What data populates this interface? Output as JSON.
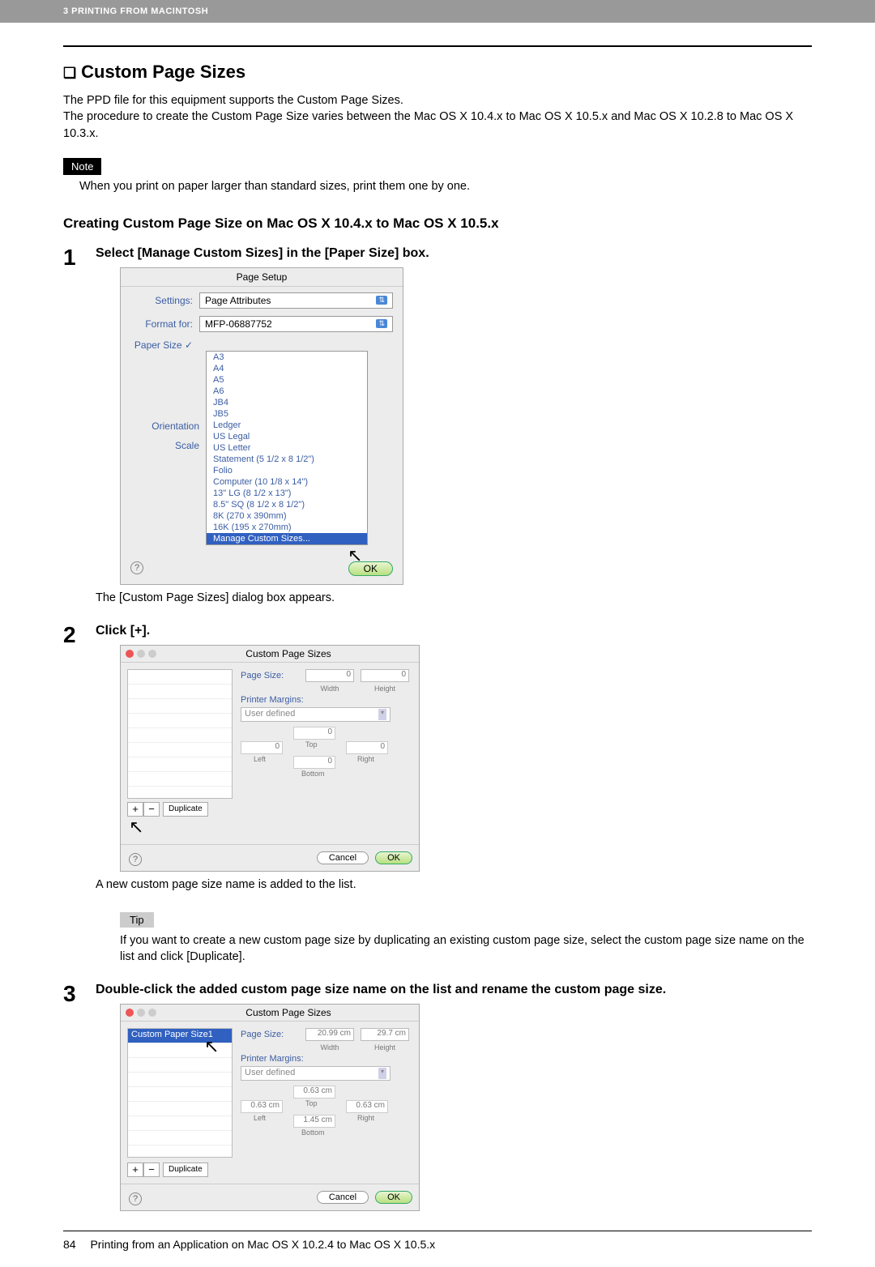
{
  "header": {
    "chapter": "3 PRINTING FROM MACINTOSH"
  },
  "section_title": "Custom Page Sizes",
  "intro": {
    "p1": "The PPD file for this equipment supports the Custom Page Sizes.",
    "p2": "The procedure to create the Custom Page Size varies between the Mac OS X 10.4.x to Mac OS X 10.5.x and Mac OS X 10.2.8 to Mac OS X 10.3.x."
  },
  "note": {
    "label": "Note",
    "text": "When you print on paper larger than standard sizes, print them one by one."
  },
  "subheading": "Creating Custom Page Size on Mac OS X 10.4.x to Mac OS X 10.5.x",
  "steps": {
    "s1": {
      "num": "1",
      "title": "Select [Manage Custom Sizes] in the [Paper Size] box.",
      "caption": "The [Custom Page Sizes] dialog box appears."
    },
    "s2": {
      "num": "2",
      "title": "Click [+].",
      "caption": "A new custom page size name is added to the list."
    },
    "s3": {
      "num": "3",
      "title": "Double-click the added custom page size name on the list and rename the custom page size."
    }
  },
  "tip": {
    "label": "Tip",
    "text": "If you want to create a new custom page size by duplicating an existing custom page size, select the custom page size name on the list and click [Duplicate]."
  },
  "page_setup": {
    "title": "Page Setup",
    "settings_lbl": "Settings:",
    "settings_val": "Page Attributes",
    "format_lbl": "Format for:",
    "format_val": "MFP-06887752",
    "papersize_lbl": "Paper Size",
    "orientation_lbl": "Orientation",
    "scale_lbl": "Scale",
    "sizes": [
      "A3",
      "A4",
      "A5",
      "A6",
      "JB4",
      "JB5",
      "Ledger",
      "US Legal",
      "US Letter",
      "Statement (5 1/2 x 8 1/2\")",
      "Folio",
      "Computer (10 1/8 x 14\")",
      "13\" LG (8 1/2 x 13\")",
      "8.5\" SQ (8 1/2 x 8 1/2\")",
      "8K (270 x 390mm)",
      "16K (195 x 270mm)"
    ],
    "checked": "✓",
    "manage": "Manage Custom Sizes...",
    "ok": "OK"
  },
  "dlg_common": {
    "title": "Custom Page Sizes",
    "page_size_lbl": "Page Size:",
    "width_lbl": "Width",
    "height_lbl": "Height",
    "margins_lbl": "Printer Margins:",
    "user_defined": "User defined",
    "top": "Top",
    "bottom": "Bottom",
    "left": "Left",
    "right": "Right",
    "duplicate": "Duplicate",
    "plus": "+",
    "minus": "−",
    "cancel": "Cancel",
    "ok": "OK",
    "help": "?"
  },
  "dlg1": {
    "w": "0",
    "h": "0",
    "t": "0",
    "b": "0",
    "l": "0",
    "r": "0"
  },
  "dlg2": {
    "list_item": "Custom Paper Size1",
    "w": "20.99 cm",
    "h": "29.7 cm",
    "t": "0.63 cm",
    "b": "1.45 cm",
    "l": "0.63 cm",
    "r": "0.63 cm"
  },
  "footer": {
    "page": "84",
    "text": "Printing from an Application on Mac OS X 10.2.4 to Mac OS X 10.5.x"
  }
}
